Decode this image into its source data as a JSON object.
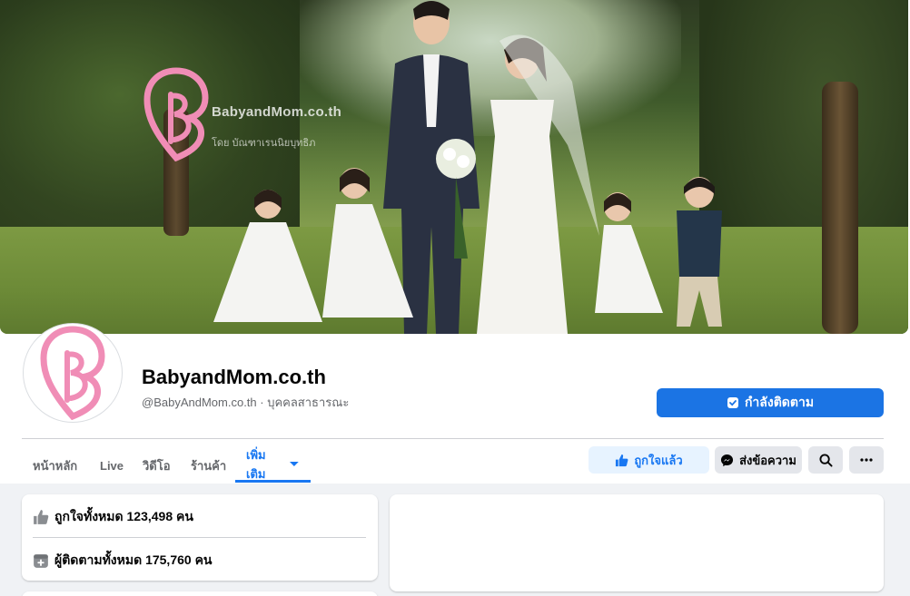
{
  "cover": {
    "brand_text": "BabyandMom.co.th",
    "sub_text": "โดย บัณฑาเรนนิยบุทธิภ"
  },
  "profile": {
    "name": "BabyandMom.co.th",
    "handle": "@BabyAndMom.co.th · บุคคลสาธารณะ"
  },
  "buttons": {
    "follow": "กำลังติดตาม",
    "liked": "ถูกใจแล้ว",
    "message": "ส่งข้อความ"
  },
  "tabs": [
    {
      "label": "หน้าหลัก"
    },
    {
      "label": "Live"
    },
    {
      "label": "วิดีโอ"
    },
    {
      "label": "ร้านค้า"
    },
    {
      "label": "เพิ่มเติม"
    }
  ],
  "stats": {
    "likes": "ถูกใจทั้งหมด 123,498 คน",
    "followers": "ผู้ติดตามทั้งหมด 175,760 คน"
  },
  "colors": {
    "accent": "#1877f2",
    "logo_pink": "#f08db6"
  },
  "icons": {
    "follow": "following-check-icon",
    "liked": "thumbs-up-icon",
    "message": "messenger-icon",
    "search": "search-icon",
    "more": "more-dots-icon",
    "dropdown": "caret-down-icon"
  }
}
